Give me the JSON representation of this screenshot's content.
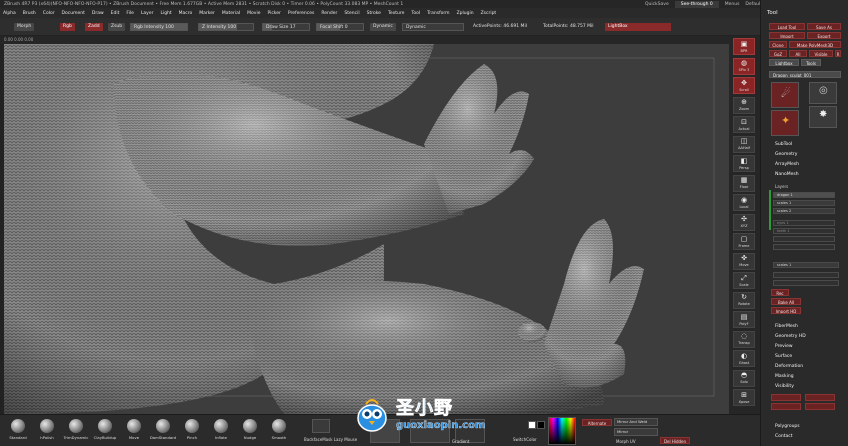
{
  "titlebar": {
    "text": "ZBrush 4R7 P3 (x64)(NFO-NFO-NFO-NFO-P17) • ZBrush Document • Free Mem 1.677GB • Active Mem 2831 • Scratch Disk 0 • Timer 0.06 • PolyCount 33.083 MP • MeshCount 1",
    "quicksave": "QuickSave",
    "see_through": "See-through 0",
    "menus": "Menus",
    "default_script": "DefaultZScript"
  },
  "menubar": {
    "items": [
      "Alpha",
      "Brush",
      "Color",
      "Document",
      "Draw",
      "Edit",
      "File",
      "Layer",
      "Light",
      "Macro",
      "Marker",
      "Material",
      "Movie",
      "Picker",
      "Preferences",
      "Render",
      "Stencil",
      "Stroke",
      "Texture",
      "Tool",
      "Transform",
      "Zplugin",
      "Zscript"
    ]
  },
  "topbar": {
    "morph": "Morph",
    "rgb": "Rgb",
    "zadd": "Zadd",
    "zsub": "Zsub",
    "rgb_intensity": "Rgb Intensity 100",
    "z_intensity": "Z Intensity 100",
    "draw_size": "Draw Size 17",
    "focal_shift": "Focal Shift 0",
    "dynamic": "Dynamic",
    "active_points": "ActivePoints: 46.691 Mil",
    "total_points": "TotalPoints: 48.757 Mil",
    "lightbox": "LightBox"
  },
  "subbar": {
    "text": "0.00 0.00 0.00"
  },
  "iconrail": {
    "items": [
      "BPR",
      "SPix 3",
      "Scroll",
      "Zoom",
      "Actual",
      "AAHalf",
      "Persp",
      "Floor",
      "Local",
      "XYZ",
      "Frame",
      "Move",
      "Scale",
      "Rotate",
      "PolyF",
      "Transp",
      "Ghost",
      "Solo",
      "Xpose"
    ]
  },
  "panel": {
    "title": "Tool",
    "buttons": [
      "Load Tool",
      "Save As",
      "Import",
      "Export",
      "Clone",
      "Make PolyMesh3D",
      "GoZ",
      "All",
      "Visible",
      "R",
      "Lightbox",
      "Tools"
    ],
    "current_tool": "Dragon_sculpt_001",
    "thumbs": [
      "Dragon",
      "Cylinder3D",
      "ZSphere",
      "PolyMesh3D"
    ],
    "sections_top": [
      "SubTool",
      "Geometry",
      "ArrayMesh",
      "NanoMesh"
    ],
    "layers_title": "Layers",
    "subtools": [
      "dragon 1",
      "scales 1",
      "scales 2",
      "eyes 1",
      "teeth 1"
    ],
    "layer_slider": "scales 1",
    "red_buttons": [
      "Rec",
      "Bake All",
      "Import HD"
    ],
    "sections_bottom": [
      "FiberMesh",
      "Geometry HD",
      "Preview",
      "Surface",
      "Deformation",
      "Masking",
      "Visibility",
      "Polygroups",
      "Contact"
    ]
  },
  "bottom": {
    "brushes": [
      "Standard",
      "hPolish",
      "TrimDynamic",
      "ClayBuildup",
      "Move",
      "DamStandard",
      "Pinch",
      "Inflate",
      "Nudge",
      "Smooth"
    ],
    "backface": "BackfaceMask Lazy Mouse",
    "gradient": "Gradient",
    "switch_color": "SwitchColor",
    "alternate": "Alternate",
    "mirror_weld": "Mirror And Weld",
    "morph_uv": "Morph UV",
    "del_hidden": "Del Hidden",
    "mirror": "Mirror"
  },
  "watermark": {
    "text": "圣小野",
    "url": "guoxiaopin.com"
  },
  "colors": {
    "accent_red": "#8b2424",
    "panel_bg": "#2a2a2a",
    "canvas_bg": "#3d3d3d"
  }
}
